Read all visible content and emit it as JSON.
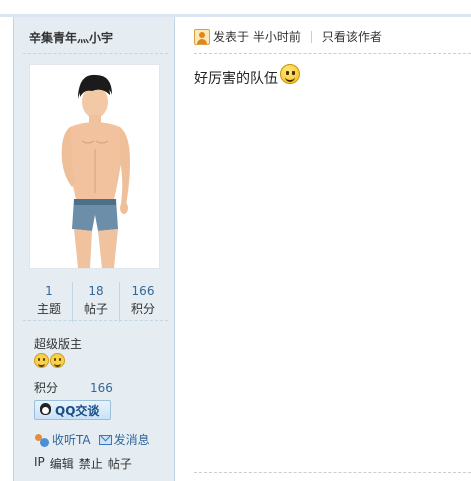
{
  "author": {
    "name": "辛集青年灬小宇",
    "stats": [
      {
        "value": "1",
        "label": "主题"
      },
      {
        "value": "18",
        "label": "帖子"
      },
      {
        "value": "166",
        "label": "积分"
      }
    ],
    "group": "超级版主",
    "credit_label": "积分",
    "credit_value": "166",
    "qq_label": "QQ交谈",
    "follow_label": "收听TA",
    "message_label": "发消息",
    "admin_links": [
      "IP",
      "编辑",
      "禁止",
      "帖子"
    ],
    "icons": [
      "smiley-icon",
      "smiley-icon",
      "qq-penguin-icon",
      "follow-user-icon",
      "mail-icon"
    ]
  },
  "post": {
    "posted_label": "发表于 半小时前",
    "only_author_label": "只看该作者",
    "content": "好厉害的队伍",
    "icons": [
      "poster-icon",
      "smiley-emoji-icon"
    ]
  },
  "colors": {
    "side_bg": "#e5edf2",
    "link": "#336699",
    "border": "#c2d5e3"
  }
}
